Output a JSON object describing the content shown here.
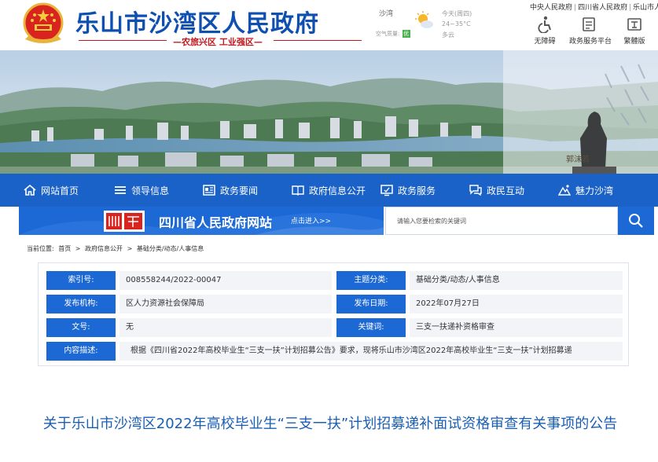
{
  "header": {
    "site_title": "乐山市沙湾区人民政府",
    "slogan": "农旅兴区  工业强区",
    "weather": {
      "place": "沙湾",
      "air_quality_label": "空气质量:",
      "aqi_badge": "优",
      "today": "今天(周四)",
      "temperature": "24~35°C",
      "condition": "多云"
    },
    "top_links": [
      "中央人民政府",
      "四川省人民政府",
      "乐山市人民政府"
    ],
    "quick_tools": [
      {
        "label": "无障碍",
        "icon": "accessibility-icon"
      },
      {
        "label": "政务服务平台",
        "icon": "service-platform-icon"
      },
      {
        "label": "繁體版",
        "icon": "traditional-chinese-icon"
      }
    ]
  },
  "banner": {
    "signature": "郭沫若"
  },
  "nav": {
    "items": [
      {
        "label": "网站首页",
        "icon": "home-icon"
      },
      {
        "label": "领导信息",
        "icon": "list-icon"
      },
      {
        "label": "政务要闻",
        "icon": "news-icon"
      },
      {
        "label": "政府信息公开",
        "icon": "book-icon"
      },
      {
        "label": "政务服务",
        "icon": "monitor-icon"
      },
      {
        "label": "政民互动",
        "icon": "chat-icon"
      },
      {
        "label": "魅力沙湾",
        "icon": "mountain-icon"
      }
    ]
  },
  "provincial": {
    "name": "四川省人民政府网站",
    "enter": "点击进入>>",
    "search_placeholder": "请输入您要检索的关键词"
  },
  "breadcrumb": {
    "label": "当前位置:",
    "items": [
      "首页",
      "政府信息公开",
      "基础分类/动态/人事信息"
    ]
  },
  "meta": {
    "index_label": "索引号:",
    "index_value": "008558244/2022-00047",
    "topic_label": "主题分类:",
    "topic_value": "基础分类/动态/人事信息",
    "org_label": "发布机构:",
    "org_value": "区人力资源社会保障局",
    "date_label": "发布日期:",
    "date_value": "2022年07月27日",
    "docno_label": "文号:",
    "docno_value": "无",
    "keyword_label": "关键词:",
    "keyword_value": "三支一扶递补资格审查",
    "desc_label": "内容描述:",
    "desc_value": "根据《四川省2022年高校毕业生“三支一扶”计划招募公告》要求，现将乐山市沙湾区2022年高校毕业生“三支一扶”计划招募递"
  },
  "article": {
    "title": "关于乐山市沙湾区2022年高校毕业生“三支一扶”计划招募递补面试资格审查有关事项的公告"
  },
  "colors": {
    "brand_blue": "#1a61c8",
    "label_blue": "#1c68d4",
    "title_blue": "#1a5fb4",
    "slogan_red": "#c4161c"
  }
}
